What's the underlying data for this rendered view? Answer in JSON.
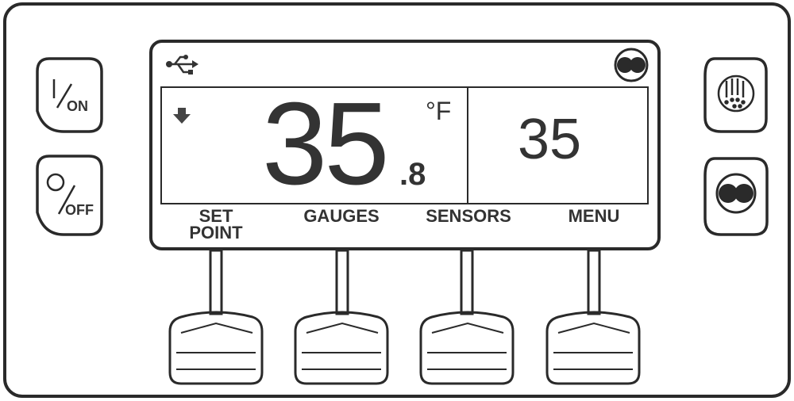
{
  "left_buttons": {
    "on_label": "ON",
    "off_label": "OFF"
  },
  "display": {
    "main_temp_int": "35",
    "main_temp_dec": ".8",
    "unit": "°F",
    "setpoint": "35"
  },
  "soft_keys": [
    {
      "label": "SET\nPOINT"
    },
    {
      "label": "GAUGES"
    },
    {
      "label": "SENSORS"
    },
    {
      "label": "MENU"
    }
  ],
  "colors": {
    "outline": "#2a2a2a",
    "text": "#333333",
    "background": "#ffffff"
  },
  "icons": [
    "usb-icon",
    "status-dots-icon",
    "down-arrow-icon",
    "defrost-icon",
    "cycle-sentry-icon"
  ]
}
